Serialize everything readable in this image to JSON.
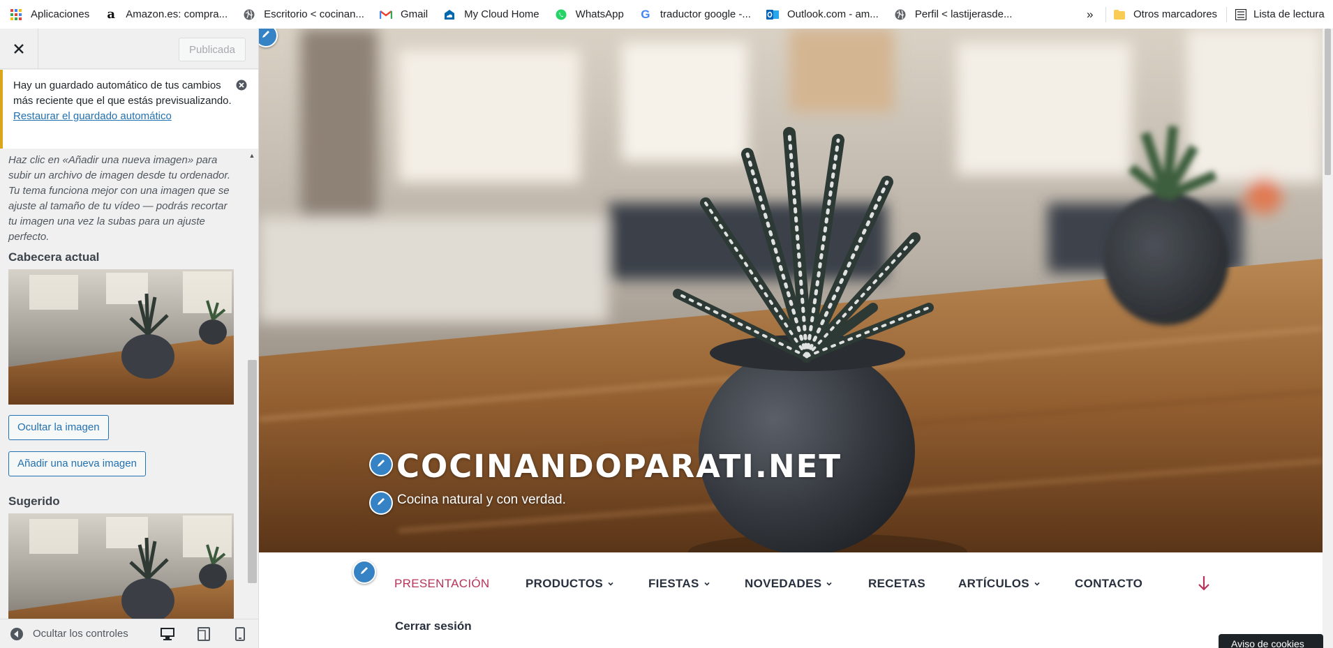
{
  "bookmarks": {
    "items": [
      {
        "label": "Aplicaciones",
        "icon": "apps-grid-icon"
      },
      {
        "label": "Amazon.es: compra...",
        "icon": "amazon-icon"
      },
      {
        "label": "Escritorio < cocinan...",
        "icon": "wordpress-globe-icon"
      },
      {
        "label": "Gmail",
        "icon": "gmail-icon"
      },
      {
        "label": "My Cloud Home",
        "icon": "cloud-icon"
      },
      {
        "label": "WhatsApp",
        "icon": "whatsapp-icon"
      },
      {
        "label": "traductor google -...",
        "icon": "google-icon"
      },
      {
        "label": "Outlook.com - am...",
        "icon": "outlook-icon"
      },
      {
        "label": "Perfil < lastijerasde...",
        "icon": "wordpress-globe-icon"
      }
    ],
    "overflow": "»",
    "other_bookmarks": "Otros marcadores",
    "reading_list": "Lista de lectura"
  },
  "customizer": {
    "published_label": "Publicada",
    "notice": {
      "text": "Hay un guardado automático de tus cambios más reciente que el que estás previsualizando.",
      "link": "Restaurar el guardado automático"
    },
    "description": "Haz clic en «Añadir una nueva imagen» para subir un archivo de imagen desde tu ordenador. Tu tema funciona mejor con una imagen que se ajuste al tamaño de tu vídeo — podrás recortar tu imagen una vez la subas para un ajuste perfecto.",
    "current_header_title": "Cabecera actual",
    "hide_image_button": "Ocultar la imagen",
    "add_image_button": "Añadir una nueva imagen",
    "suggested_title": "Sugerido",
    "footer": {
      "hide_controls": "Ocultar los controles"
    }
  },
  "site": {
    "title": "COCINANDOPARATI.NET",
    "tagline": "Cocina natural y con verdad.",
    "menu": [
      {
        "label": "PRESENTACIÓN",
        "active": true,
        "submenu": false
      },
      {
        "label": "PRODUCTOS",
        "active": false,
        "submenu": true
      },
      {
        "label": "FIESTAS",
        "active": false,
        "submenu": true
      },
      {
        "label": "NOVEDADES",
        "active": false,
        "submenu": true
      },
      {
        "label": "RECETAS",
        "active": false,
        "submenu": false
      },
      {
        "label": "ARTÍCULOS",
        "active": false,
        "submenu": true
      },
      {
        "label": "CONTACTO",
        "active": false,
        "submenu": false
      }
    ],
    "logout": "Cerrar sesión",
    "cookies": "Aviso de cookies"
  },
  "colors": {
    "accent_active": "#b5345a",
    "wp_blue": "#2271b1",
    "notice_warning": "#dba617"
  }
}
